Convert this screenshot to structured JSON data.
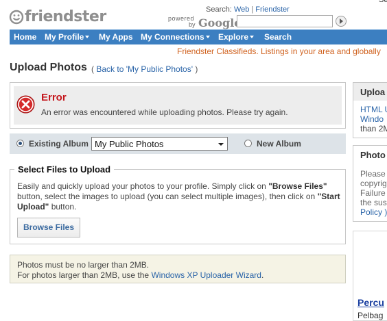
{
  "header": {
    "logo_text": "friendster",
    "top_right_clip": "Se",
    "search_label": "Search:",
    "search_web": "Web",
    "search_separator": "|",
    "search_friendster": "Friendster",
    "powered_by_1": "powered",
    "powered_by_2": "by",
    "google_text": "Google",
    "search_input_value": ""
  },
  "nav": {
    "items": [
      {
        "label": "Home"
      },
      {
        "label": "My Profile"
      },
      {
        "label": "My Apps"
      },
      {
        "label": "My Connections"
      },
      {
        "label": "Explore"
      },
      {
        "label": "Search"
      }
    ]
  },
  "classifieds_text": "Friendster Classifieds. Listings in your area and globally",
  "page": {
    "title": "Upload Photos",
    "back_prefix": "(",
    "back_link": "Back to 'My Public Photos'",
    "back_suffix": ")"
  },
  "error": {
    "title": "Error",
    "message": "An error was encountered while uploading photos. Please try again."
  },
  "album": {
    "existing_label": "Existing Album",
    "selected_album": "My Public Photos",
    "new_label": "New Album",
    "existing_selected": true
  },
  "files": {
    "legend": "Select Files to Upload",
    "desc_1": "Easily and quickly upload your photos to your profile. Simply click on ",
    "desc_browse": "\"Browse Files\"",
    "desc_2": " button, select the images to upload (you can select multiple images), then click on ",
    "desc_start": "\"Start Upload\"",
    "desc_3": " button.",
    "browse_button": "Browse Files"
  },
  "notes": {
    "line1": "Photos must be no larger than 2MB.",
    "line2_prefix": "For photos larger than 2MB, use the ",
    "line2_link": "Windows XP Uploader Wizard",
    "line2_suffix": "."
  },
  "sidebar": {
    "box1_title": "Uploa",
    "box1_lines": [
      "HTML U",
      "Windo",
      "than 2M"
    ],
    "box2_title": "Photo",
    "box2_lines": [
      "Please",
      "copyrig",
      "Failure",
      "the sus",
      "Policy )"
    ],
    "ad_title": "Percu",
    "ad_sub": "Pelbag"
  },
  "colors": {
    "nav_bg": "#3c7fc1",
    "link": "#2a64a8",
    "error_red": "#c4161c",
    "classifieds": "#d0621f",
    "album_bar": "#dde3e8",
    "notes_bg": "#f5f3e5"
  },
  "icons": {
    "logo": "smiley-face-icon",
    "search_go": "arrow-right-icon",
    "error": "error-x-icon",
    "nav_caret": "caret-down-icon"
  }
}
